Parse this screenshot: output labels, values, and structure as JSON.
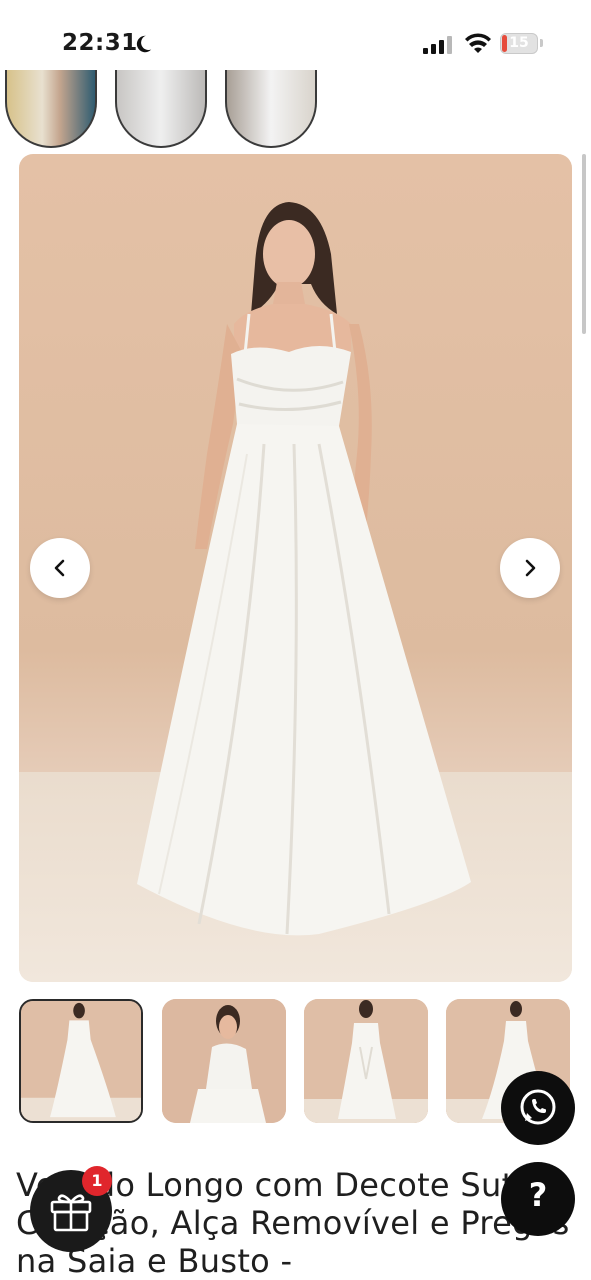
{
  "status_bar": {
    "time": "22:31",
    "battery_level": "15"
  },
  "product": {
    "title": "Vestido Longo com Decote Sutiã Coração, Alça Removível e Pregas na Saia e Busto -"
  },
  "gift": {
    "badge_count": "1"
  },
  "help": {
    "label": "?"
  },
  "icons": [
    "moon-icon",
    "signal-icon",
    "wifi-icon",
    "battery-icon",
    "chevron-left-icon",
    "chevron-right-icon",
    "whatsapp-icon",
    "gift-icon"
  ]
}
